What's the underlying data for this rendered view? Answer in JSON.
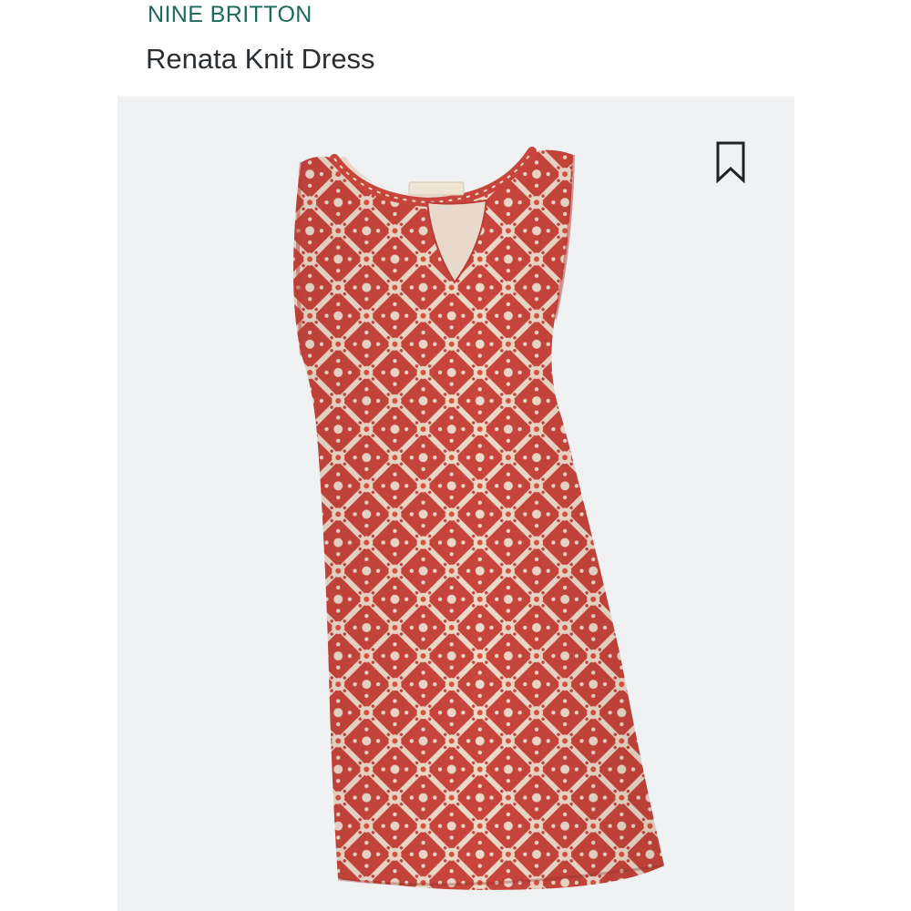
{
  "product": {
    "brand": "NINE BRITTON",
    "title": "Renata Knit Dress"
  },
  "image": {
    "subject": "dress",
    "colors": {
      "base": "#c8453c",
      "print": "#ecd9c8",
      "background": "#f0f1f3"
    }
  },
  "icons": {
    "save": "bookmark-icon"
  },
  "colors": {
    "brand": "#1d6a5b",
    "title": "#2b2f33"
  }
}
